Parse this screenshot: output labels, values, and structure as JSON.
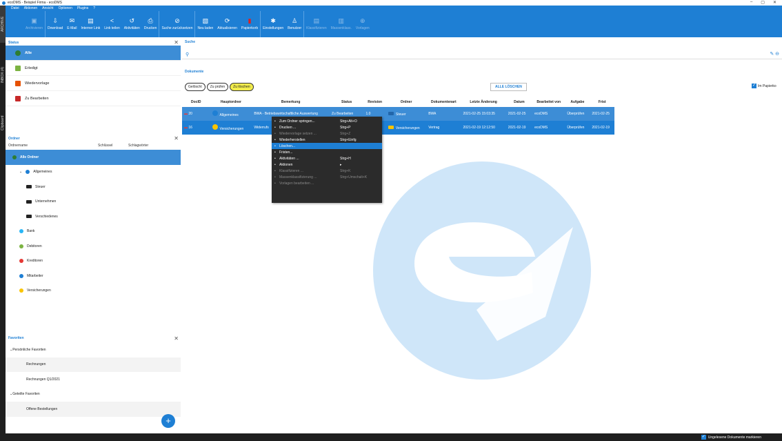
{
  "window": {
    "title": "ecoDMS - Beispiel Firma - ecoDMS",
    "min": "–",
    "max": "▢",
    "close": "✕"
  },
  "menu": [
    "Datei",
    "Aktionen",
    "Ansicht",
    "Optionen",
    "Plugins",
    "?"
  ],
  "toolbar": [
    {
      "label": "Archivieren",
      "icon": "archive-icon",
      "glyph": "▣",
      "enabled": false
    },
    {
      "label": "Download",
      "icon": "download-icon",
      "glyph": "⇩",
      "enabled": true
    },
    {
      "label": "E-Mail",
      "icon": "mail-icon",
      "glyph": "✉",
      "enabled": true
    },
    {
      "label": "Interner Link",
      "icon": "link-icon",
      "glyph": "▤",
      "enabled": true
    },
    {
      "label": "Link teilen",
      "icon": "share-icon",
      "glyph": "<",
      "enabled": true
    },
    {
      "label": "Aktivitäten",
      "icon": "history-icon",
      "glyph": "↺",
      "enabled": true
    },
    {
      "label": "Drucken",
      "icon": "print-icon",
      "glyph": "⎙",
      "enabled": true
    },
    {
      "label": "Suche zurücksetzen",
      "icon": "reset-icon",
      "glyph": "⊘",
      "enabled": true
    },
    {
      "label": "Neu laden",
      "icon": "reload-icon",
      "glyph": "▧",
      "enabled": true
    },
    {
      "label": "Aktualisieren",
      "icon": "refresh-icon",
      "glyph": "⟳",
      "enabled": true
    },
    {
      "label": "Papierkorb",
      "icon": "trash-icon",
      "glyph": "▮",
      "enabled": true
    },
    {
      "label": "Einstellungen",
      "icon": "settings-icon",
      "glyph": "✱",
      "enabled": true
    },
    {
      "label": "Benutzer",
      "icon": "user-icon",
      "glyph": "♙",
      "enabled": true
    },
    {
      "label": "Klassifizieren",
      "icon": "classify-icon",
      "glyph": "▤",
      "enabled": false
    },
    {
      "label": "Massenklass.",
      "icon": "mass-classify-icon",
      "glyph": "▥",
      "enabled": false
    },
    {
      "label": "Vorlagen",
      "icon": "template-icon",
      "glyph": "⊕",
      "enabled": false
    }
  ],
  "sidetabs": [
    "ARCHIVE",
    "INBOX (4)",
    "Clipboard"
  ],
  "status": {
    "title": "Status",
    "items": [
      {
        "label": "Alle",
        "icon": "all-icon",
        "color": "#2e7d32"
      },
      {
        "label": "Erledigt",
        "icon": "flag-icon",
        "color": "#7cb342"
      },
      {
        "label": "Wiedervorlage",
        "icon": "alarm-icon",
        "color": "#e65100"
      },
      {
        "label": "Zu Bearbeiten",
        "icon": "pen-icon",
        "color": "#c62828"
      }
    ]
  },
  "ordner": {
    "title": "Ordner",
    "cols": [
      "Ordnername",
      "Schlüssel",
      "Schlagwörter"
    ],
    "items": [
      {
        "label": "Alle Ordner",
        "level": 0,
        "icon": "all-folders-icon",
        "color": "#2e7d32"
      },
      {
        "label": "Allgemeines",
        "level": 1,
        "icon": "info-icon",
        "color": "#1e7fd4"
      },
      {
        "label": "Steuer",
        "level": 2,
        "icon": "folder-icon",
        "color": "#222"
      },
      {
        "label": "Unternehmen",
        "level": 2,
        "icon": "folder-icon",
        "color": "#222"
      },
      {
        "label": "Verschiedenes",
        "level": 2,
        "icon": "folder-icon",
        "color": "#222"
      },
      {
        "label": "Bank",
        "level": 1,
        "icon": "bank-icon",
        "color": "#29b6f6"
      },
      {
        "label": "Debitoren",
        "level": 1,
        "icon": "debitor-icon",
        "color": "#7cb342"
      },
      {
        "label": "Kreditoren",
        "level": 1,
        "icon": "kreditor-icon",
        "color": "#e53935"
      },
      {
        "label": "Mitarbeiter",
        "level": 1,
        "icon": "employee-icon",
        "color": "#1e7fd4"
      },
      {
        "label": "Versicherungen",
        "level": 1,
        "icon": "insurance-icon",
        "color": "#f9c400"
      }
    ]
  },
  "favoriten": {
    "title": "Favoriten",
    "items": [
      {
        "label": "Persönliche Favoriten",
        "group": true
      },
      {
        "label": "Rechnungen",
        "group": false
      },
      {
        "label": "Rechnungen Q1/2021",
        "group": false
      },
      {
        "label": "Geteilte Favoriten",
        "group": true
      },
      {
        "label": "Offene Bestellungen",
        "group": false
      }
    ],
    "add": "+"
  },
  "search": {
    "title": "Suche"
  },
  "docs": {
    "title": "Dokumente",
    "filters": [
      {
        "label": "Gelöscht",
        "active": false
      },
      {
        "label": "Zu prüfen",
        "active": false
      },
      {
        "label": "Zu löschen",
        "active": true
      }
    ],
    "clear_all": "ALLE LÖSCHEN",
    "paper_check": "Im Papierko",
    "columns": [
      "DocID",
      "Hauptordner",
      "Bemerkung",
      "Status",
      "Revision",
      "Ordner",
      "Dokumentenart",
      "Letzte Änderung",
      "Datum",
      "Bearbeitet von",
      "Aufgabe",
      "Frist"
    ],
    "rows": [
      {
        "id": "20",
        "haupt": "Allgemeines",
        "bem": "BWA - Betriebswirtschaftliche Auswertung",
        "status": "Zu Bearbeiten",
        "rev": "1.0",
        "ordner": "Steuer",
        "art": "BWA",
        "last": "2021-02-25 15:03:35",
        "datum": "2021-02-25",
        "von": "ecoDMS",
        "aufgabe": "Überprüfen",
        "frist": "2021-02-25"
      },
      {
        "id": "16",
        "haupt": "Versicherungen",
        "bem": "Widerrufs",
        "status": "",
        "rev": "",
        "ordner": "Versicherungen",
        "art": "Vertrag",
        "last": "2021-02-19 12:12:50",
        "datum": "2021-02-19",
        "von": "ecoDMS",
        "aufgabe": "Überprüfen",
        "frist": "2021-02-19"
      }
    ]
  },
  "context": [
    {
      "label": "Zum Ordner springen...",
      "key": "Strg+Alt+O",
      "enabled": true,
      "highlight": false,
      "icon": "jump-icon"
    },
    {
      "label": "Drucken ...",
      "key": "Strg+P",
      "enabled": true,
      "highlight": false,
      "icon": "print-icon"
    },
    {
      "label": "Wiedervorlage setzen ...",
      "key": "Strg+Z",
      "enabled": false,
      "highlight": false,
      "icon": "alarm-icon"
    },
    {
      "label": "Wiederherstellen",
      "key": "Strg+Einfg",
      "enabled": true,
      "highlight": false,
      "icon": "restore-icon"
    },
    {
      "label": "Löschen...",
      "key": "",
      "enabled": true,
      "highlight": true,
      "icon": "delete-icon"
    },
    {
      "label": "Fristen...",
      "key": "",
      "enabled": true,
      "highlight": false,
      "icon": "deadline-icon"
    },
    {
      "label": "Aktivitäten ...",
      "key": "Strg+H",
      "enabled": true,
      "highlight": false,
      "icon": "history-icon"
    },
    {
      "label": "Aktionen",
      "key": "▸",
      "enabled": true,
      "highlight": false,
      "icon": "share-icon"
    },
    {
      "label": "Klassifizieren ...",
      "key": "Strg+K",
      "enabled": false,
      "highlight": false,
      "icon": "classify-icon"
    },
    {
      "label": "Massenklassifizierung ...",
      "key": "Strg+Umschalt+K",
      "enabled": false,
      "highlight": false,
      "icon": "mass-classify-icon"
    },
    {
      "label": "Vorlagen bearbeiten ...",
      "key": "",
      "enabled": false,
      "highlight": false,
      "icon": "template-icon"
    }
  ],
  "bottom": {
    "label": "Ungelesene Dokumente markieren"
  },
  "colors": {
    "accent": "#1e7fd4",
    "selected": "#3d8dd6",
    "watermark": "#cfe6f9"
  }
}
